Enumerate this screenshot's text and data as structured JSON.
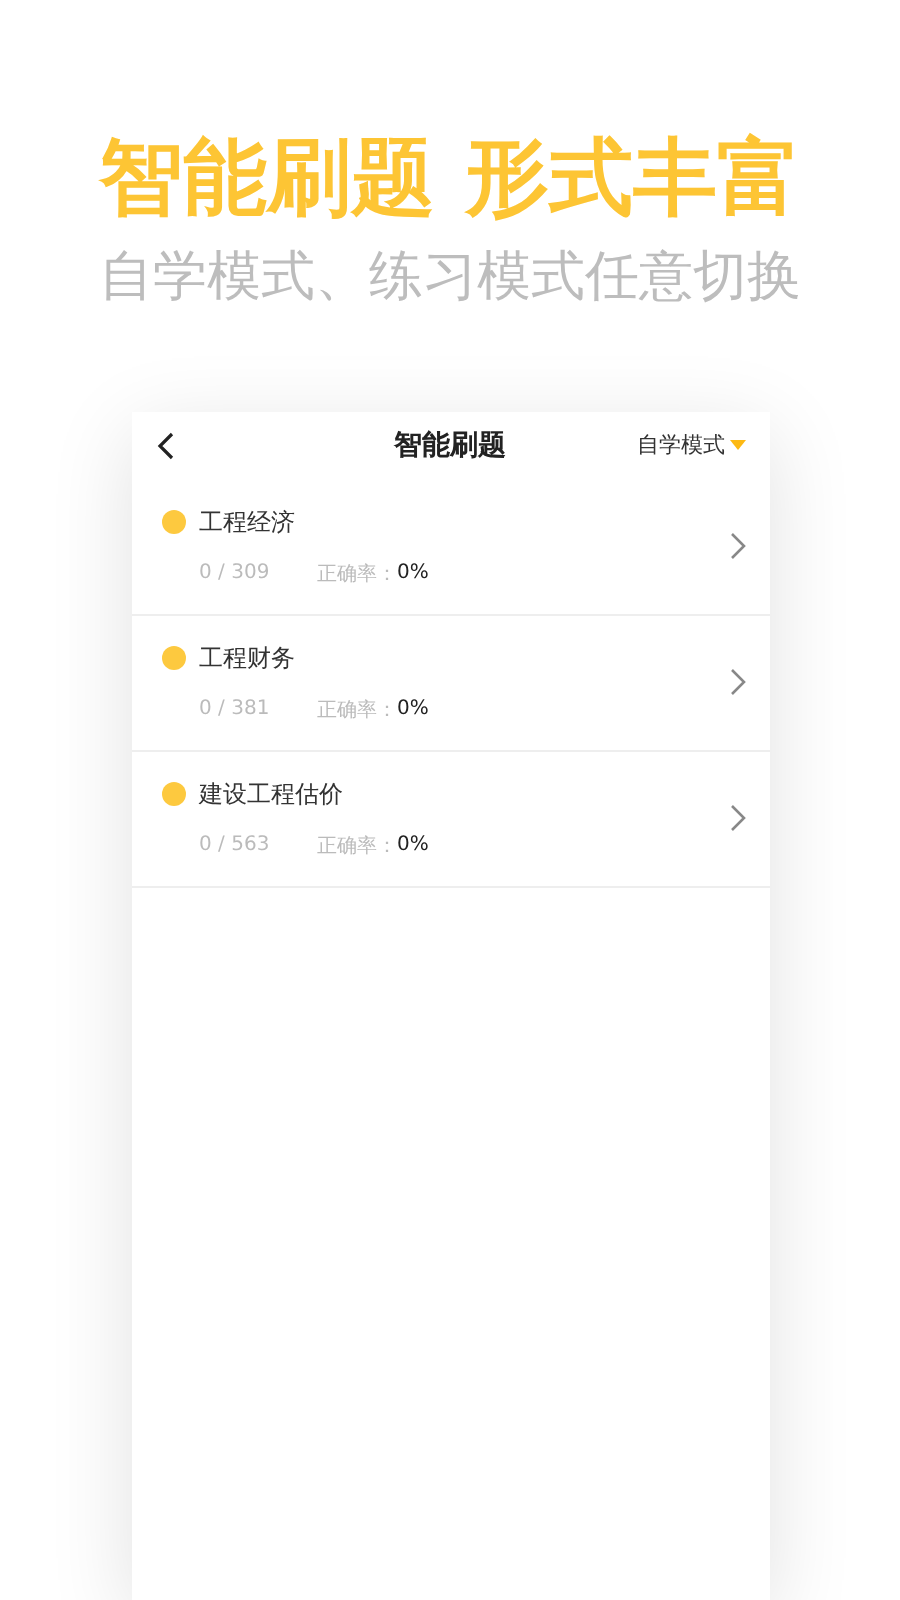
{
  "promo": {
    "headline": "智能刷题 形式丰富",
    "subtitle": "自学模式、练习模式任意切换"
  },
  "screen": {
    "title": "智能刷题",
    "mode": "自学模式",
    "subjects": [
      {
        "name": "工程经济",
        "progress": "0 / 309",
        "accuracy_label": "正确率：",
        "accuracy": "0%"
      },
      {
        "name": "工程财务",
        "progress": "0 / 381",
        "accuracy_label": "正确率：",
        "accuracy": "0%"
      },
      {
        "name": "建设工程估价",
        "progress": "0 / 563",
        "accuracy_label": "正确率：",
        "accuracy": "0%"
      }
    ]
  }
}
